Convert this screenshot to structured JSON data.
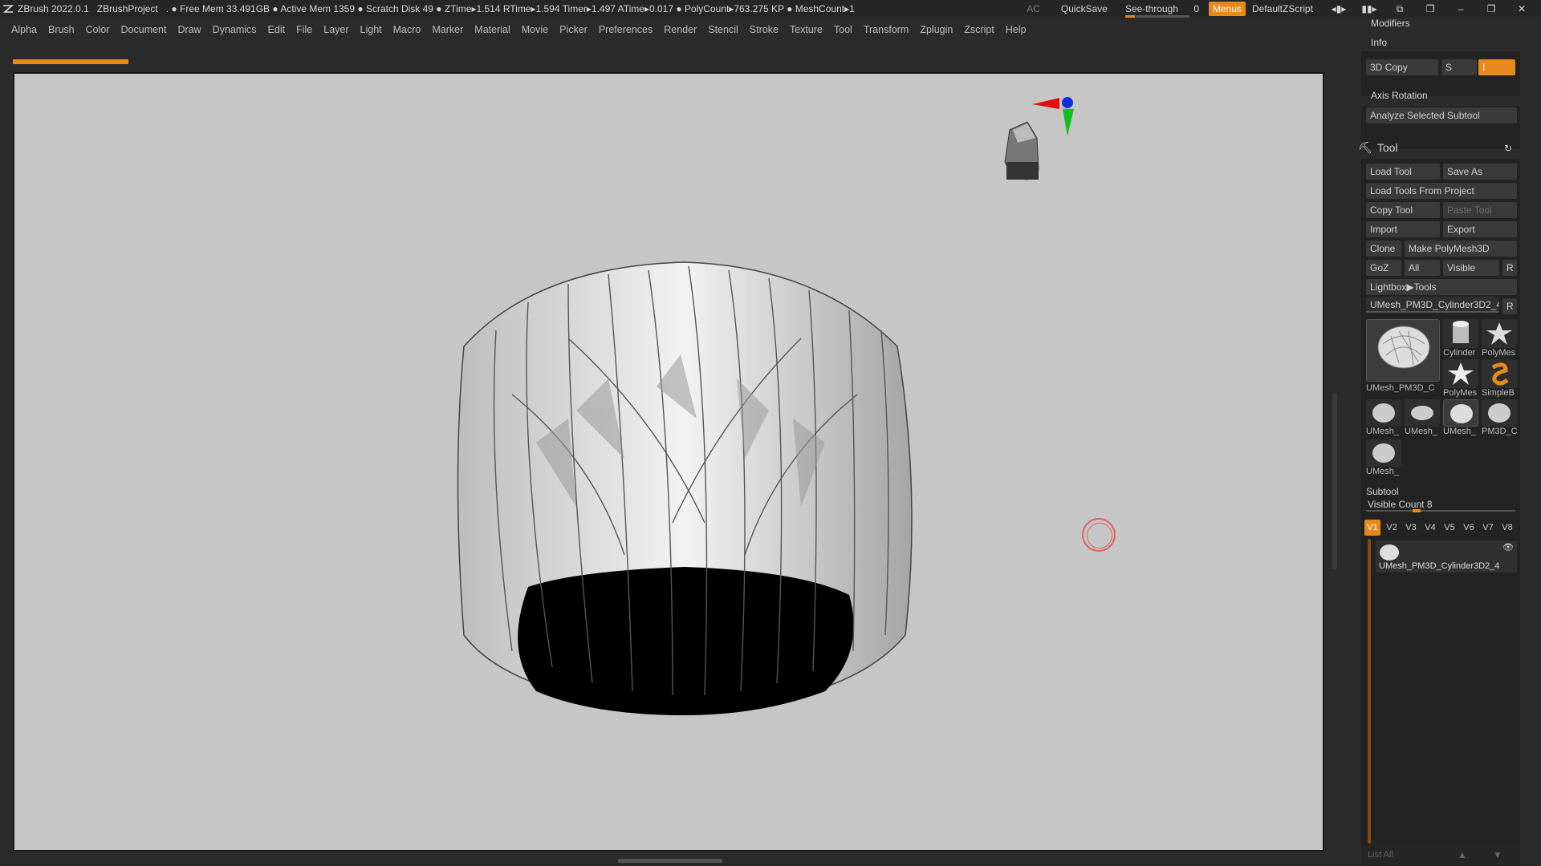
{
  "titlebar": {
    "app": "ZBrush 2022.0.1",
    "project": "ZBrushProject",
    "stats": ". ● Free Mem 33.491GB ● Active Mem 1359 ● Scratch Disk 49 ● ZTime▸1.514 RTime▸1.594 Timer▸1.497 ATime▸0.017 ● PolyCount▸763.275 KP ● MeshCount▸1",
    "ac": "AC",
    "quicksave": "QuickSave",
    "seethrough": "See-through",
    "seethrough_value": "0",
    "seethrough_level": 0.0,
    "menus": "Menus",
    "script": "DefaultZScript"
  },
  "menubar": [
    "Alpha",
    "Brush",
    "Color",
    "Document",
    "Draw",
    "Dynamics",
    "Edit",
    "File",
    "Layer",
    "Light",
    "Macro",
    "Marker",
    "Material",
    "Movie",
    "Picker",
    "Preferences",
    "Render",
    "Stencil",
    "Stroke",
    "Texture",
    "Tool",
    "Transform",
    "Zplugin",
    "Zscript",
    "Help"
  ],
  "panel": {
    "modifiers": "Modifiers",
    "info": "Info",
    "copy3d": "3D Copy",
    "s_label": "S",
    "i_label": "I",
    "axis_rotation": "Axis Rotation",
    "analyze": "Analyze Selected Subtool",
    "tool_title": "Tool",
    "load_tool": "Load Tool",
    "save_as": "Save As",
    "load_from_project": "Load Tools From Project",
    "copy_tool": "Copy Tool",
    "paste_tool": "Paste Tool",
    "import": "Import",
    "export": "Export",
    "clone": "Clone",
    "make_polymesh": "Make PolyMesh3D",
    "goz": "GoZ",
    "all": "All",
    "visible": "Visible",
    "r": "R",
    "lightbox_tools": "Lightbox▶Tools",
    "current_tool": "UMesh_PM3D_Cylinder3D2_4",
    "thumbs": {
      "big": "UMesh_PM3D_C",
      "cylinder": "Cylinder",
      "polymesh1": "PolyMes",
      "polymesh2": "PolyMes",
      "simpleb": "SimpleB",
      "s1": "UMesh_",
      "s2": "UMesh_",
      "s3": "UMesh_",
      "s4": "PM3D_C",
      "s5": "UMesh_"
    },
    "subtool_title": "Subtool",
    "visible_count": "Visible Count 8",
    "versions": [
      "V1",
      "V2",
      "V3",
      "V4",
      "V5",
      "V6",
      "V7",
      "V8"
    ],
    "subtool_name": "UMesh_PM3D_Cylinder3D2_4",
    "list_all": "List All"
  },
  "colors": {
    "accent": "#e8891d",
    "viewport_bg": "#c6c6c6",
    "panel_bg": "#2b2b2b"
  }
}
